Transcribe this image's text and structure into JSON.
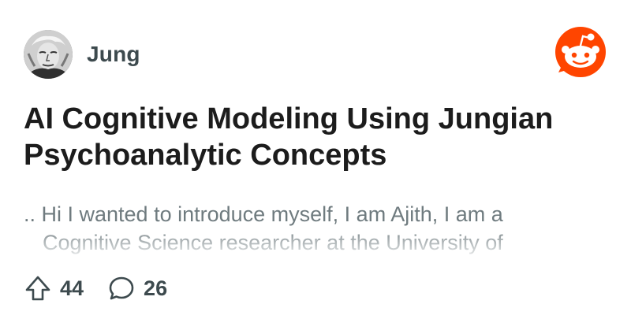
{
  "post": {
    "username": "Jung",
    "title": "AI Cognitive Modeling Using Jungian Psychoanalytic Concepts",
    "excerpt_line1": ".. Hi I wanted to introduce myself, I am Ajith, I am a",
    "excerpt_line2": "Cognitive Science researcher at the University of"
  },
  "stats": {
    "upvotes": "44",
    "comments": "26"
  },
  "icons": {
    "avatar": "user-avatar-portrait",
    "logo": "reddit-logo-icon",
    "upvote": "upvote-arrow-icon",
    "comment": "comment-bubble-icon"
  },
  "colors": {
    "reddit_orange": "#ff4500",
    "username": "#3d4a4e",
    "title": "#1c1c1c",
    "excerpt": "#6f7b7f"
  }
}
